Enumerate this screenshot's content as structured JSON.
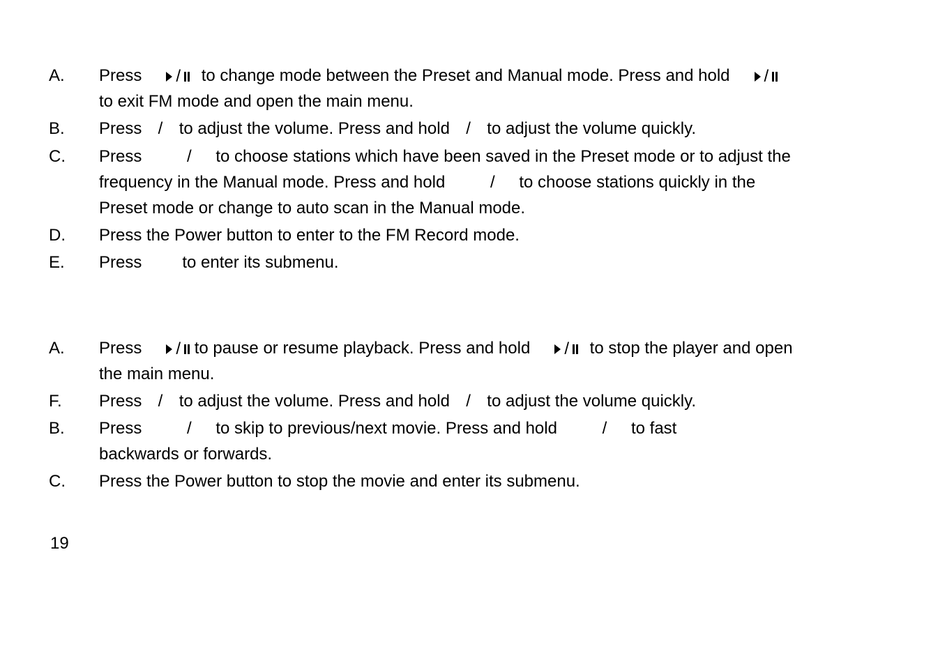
{
  "pageNumber": "19",
  "list1": [
    {
      "marker": "A.",
      "segments": [
        {
          "t": "text",
          "v": "Press"
        },
        {
          "t": "spacer",
          "cls": "pp-spacer-before"
        },
        {
          "t": "pp"
        },
        {
          "t": "spacer",
          "cls": "gap-sm"
        },
        {
          "t": "text",
          "v": " to change mode between the Preset and Manual mode. Press and hold"
        },
        {
          "t": "spacer",
          "cls": "pp-spacer-before"
        },
        {
          "t": "pp"
        },
        {
          "t": "br"
        },
        {
          "t": "text",
          "v": "to exit FM mode and open the main menu."
        }
      ]
    },
    {
      "marker": "B.",
      "segments": [
        {
          "t": "text",
          "v": "Press "
        },
        {
          "t": "spacer",
          "cls": "gap-sm"
        },
        {
          "t": "text",
          "v": " / "
        },
        {
          "t": "spacer",
          "cls": "gap-sm"
        },
        {
          "t": "text",
          "v": " to adjust the volume. Press and hold "
        },
        {
          "t": "spacer",
          "cls": "gap-sm"
        },
        {
          "t": "text",
          "v": " / "
        },
        {
          "t": "spacer",
          "cls": "gap-sm"
        },
        {
          "t": "text",
          "v": " to adjust the volume quickly."
        }
      ]
    },
    {
      "marker": "C.",
      "segments": [
        {
          "t": "text",
          "v": "Press"
        },
        {
          "t": "spacer",
          "cls": "gap-wide"
        },
        {
          "t": "text",
          "v": " /"
        },
        {
          "t": "spacer",
          "cls": "gap-med"
        },
        {
          "t": "text",
          "v": " to choose stations which have been saved in the Preset mode or to adjust the "
        },
        {
          "t": "br"
        },
        {
          "t": "text",
          "v": "frequency in the Manual mode. Press and hold"
        },
        {
          "t": "spacer",
          "cls": "gap-wide"
        },
        {
          "t": "text",
          "v": " /"
        },
        {
          "t": "spacer",
          "cls": "gap-med"
        },
        {
          "t": "text",
          "v": " to choose stations quickly in the "
        },
        {
          "t": "br"
        },
        {
          "t": "text",
          "v": "Preset mode or change to auto scan in the Manual mode."
        }
      ]
    },
    {
      "marker": "D.",
      "segments": [
        {
          "t": "text",
          "v": "Press the Power button to enter to the FM Record mode."
        }
      ]
    },
    {
      "marker": "E.",
      "segments": [
        {
          "t": "text",
          "v": "Press"
        },
        {
          "t": "spacer",
          "cls": "gap-wide"
        },
        {
          "t": "text",
          "v": "to enter its submenu."
        }
      ]
    }
  ],
  "list2": [
    {
      "marker": "A.",
      "segments": [
        {
          "t": "text",
          "v": "Press"
        },
        {
          "t": "spacer",
          "cls": "pp-spacer-before"
        },
        {
          "t": "pp"
        },
        {
          "t": "text",
          "v": " to pause or resume playback. Press and hold"
        },
        {
          "t": "spacer",
          "cls": "pp-spacer-before"
        },
        {
          "t": "pp"
        },
        {
          "t": "spacer",
          "cls": "gap-sm"
        },
        {
          "t": "text",
          "v": " to stop the player and open "
        },
        {
          "t": "br"
        },
        {
          "t": "text",
          "v": "the main menu."
        }
      ]
    },
    {
      "marker": "F.",
      "segments": [
        {
          "t": "text",
          "v": "Press "
        },
        {
          "t": "spacer",
          "cls": "gap-sm"
        },
        {
          "t": "text",
          "v": " / "
        },
        {
          "t": "spacer",
          "cls": "gap-sm"
        },
        {
          "t": "text",
          "v": " to adjust the volume. Press and hold "
        },
        {
          "t": "spacer",
          "cls": "gap-sm"
        },
        {
          "t": "text",
          "v": " / "
        },
        {
          "t": "spacer",
          "cls": "gap-sm"
        },
        {
          "t": "text",
          "v": " to adjust the volume quickly."
        }
      ]
    },
    {
      "marker": "B.",
      "segments": [
        {
          "t": "text",
          "v": "Press"
        },
        {
          "t": "spacer",
          "cls": "gap-wide"
        },
        {
          "t": "text",
          "v": " /"
        },
        {
          "t": "spacer",
          "cls": "gap-med"
        },
        {
          "t": "text",
          "v": " to skip to previous/next movie. Press and hold"
        },
        {
          "t": "spacer",
          "cls": "gap-wide"
        },
        {
          "t": "text",
          "v": " /"
        },
        {
          "t": "spacer",
          "cls": "gap-med"
        },
        {
          "t": "text",
          "v": " to fast "
        },
        {
          "t": "br"
        },
        {
          "t": "text",
          "v": "backwards or forwards."
        }
      ]
    },
    {
      "marker": "C.",
      "segments": [
        {
          "t": "text",
          "v": "Press the Power button to stop the movie and enter its submenu."
        }
      ]
    }
  ]
}
